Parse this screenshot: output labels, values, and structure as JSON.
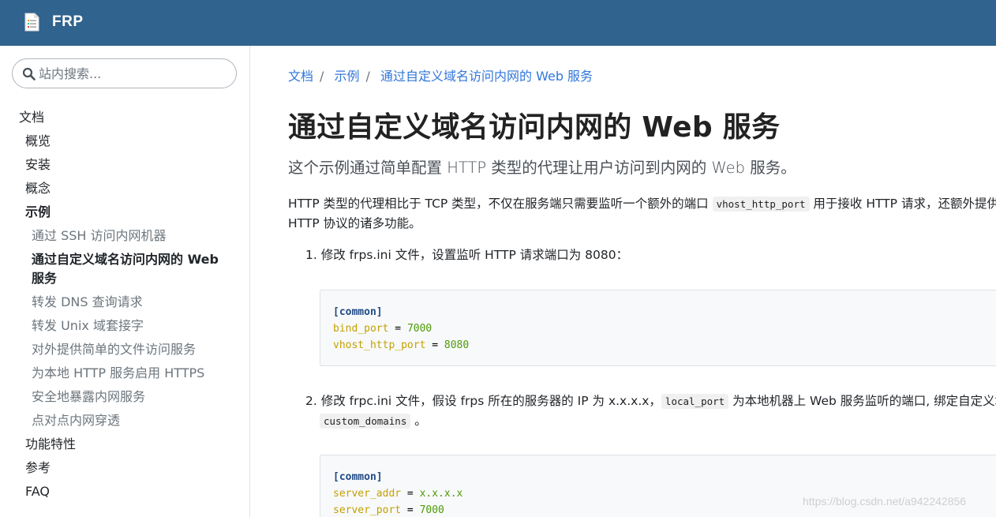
{
  "header": {
    "brand": "FRP",
    "logo_icon": "document-list-icon",
    "color": "#30638e"
  },
  "sidebar": {
    "search_placeholder": "站内搜索...",
    "items": [
      {
        "label": "文档",
        "level": 0
      },
      {
        "label": "概览",
        "level": 1
      },
      {
        "label": "安装",
        "level": 1
      },
      {
        "label": "概念",
        "level": 1
      },
      {
        "label": "示例",
        "level": 1,
        "bold": true
      },
      {
        "label": "通过 SSH 访问内网机器",
        "level": 2
      },
      {
        "label": "通过自定义域名访问内网的 Web 服务",
        "level": 2,
        "active": true
      },
      {
        "label": "转发 DNS 查询请求",
        "level": 2
      },
      {
        "label": "转发 Unix 域套接字",
        "level": 2
      },
      {
        "label": "对外提供简单的文件访问服务",
        "level": 2
      },
      {
        "label": "为本地 HTTP 服务启用 HTTPS",
        "level": 2
      },
      {
        "label": "安全地暴露内网服务",
        "level": 2
      },
      {
        "label": "点对点内网穿透",
        "level": 2
      },
      {
        "label": "功能特性",
        "level": 1
      },
      {
        "label": "参考",
        "level": 1
      },
      {
        "label": "FAQ",
        "level": 1
      }
    ]
  },
  "breadcrumb": [
    "文档",
    "示例",
    "通过自定义域名访问内网的 Web 服务"
  ],
  "page": {
    "title": "通过自定义域名访问内网的 Web 服务",
    "lead": "这个示例通过简单配置 HTTP 类型的代理让用户访问到内网的 Web 服务。",
    "para_1a": "HTTP 类型的代理相比于 TCP 类型，不仅在服务端只需要监听一个额外的端口 ",
    "para_code": "vhost_http_port",
    "para_1b": " 用于接收 HTTP 请求，还额外提供了基于",
    "para_2": "HTTP 协议的诸多功能。",
    "step1_num": "1.",
    "step1": "修改 frps.ini 文件，设置监听 HTTP 请求端口为 8080：",
    "step2_num": "2.",
    "step2a": "修改 frpc.ini 文件，假设 frps 所在的服务器的 IP 为 x.x.x.x，",
    "step2_code1": "local_port",
    "step2b": " 为本地机器上 Web 服务监听的端口, 绑定自定义域名",
    "step2_code2": "custom_domains",
    "step2c": " 。"
  },
  "code_block_1": {
    "section": "[common]",
    "lines": [
      {
        "key": "bind_port",
        "op": " = ",
        "value": "7000"
      },
      {
        "key": "vhost_http_port",
        "op": " = ",
        "value": "8080"
      }
    ]
  },
  "code_block_2": {
    "section": "[common]",
    "lines": [
      {
        "key": "server_addr",
        "op": " = ",
        "value": "x.x.x.x"
      },
      {
        "key": "server_port",
        "op": " = ",
        "value": "7000"
      }
    ]
  },
  "watermark": "https://blog.csdn.net/a942242856"
}
